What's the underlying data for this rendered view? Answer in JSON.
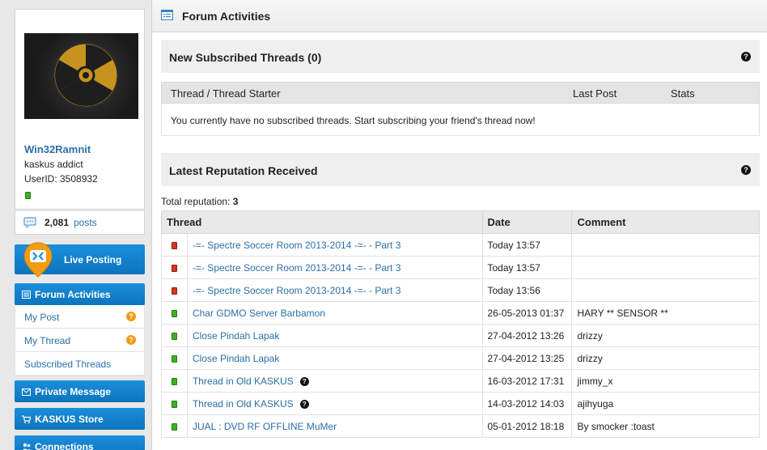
{
  "sidebar": {
    "username": "Win32Ramnit",
    "user_title": "kaskus addict",
    "user_id": "UserID: 3508932",
    "post_count": "2,081",
    "post_label": "posts",
    "live_posting": "Live Posting",
    "nav": {
      "forum_activities": "Forum Activities",
      "my_post": "My Post",
      "my_thread": "My Thread",
      "subscribed_threads": "Subscribed Threads",
      "private_message": "Private Message",
      "kaskus_store": "KASKUS Store",
      "connections": "Connections"
    },
    "help_glyph": "?"
  },
  "main": {
    "page_title": "Forum Activities",
    "subscribed": {
      "title": "New Subscribed Threads (0)",
      "col_thread": "Thread / Thread Starter",
      "col_last_post": "Last Post",
      "col_stats": "Stats",
      "empty_message": "You currently have no subscribed threads. Start subscribing your friend's thread now!"
    },
    "reputation": {
      "title": "Latest Reputation Received",
      "total_label": "Total reputation: ",
      "total_value": "3",
      "col_thread": "Thread",
      "col_date": "Date",
      "col_comment": "Comment",
      "rows": [
        {
          "status": "red",
          "thread": "-=- Spectre Soccer Room 2013-2014 -=- - Part 3",
          "help": false,
          "date": "Today 13:57",
          "comment": ""
        },
        {
          "status": "red",
          "thread": "-=- Spectre Soccer Room 2013-2014 -=- - Part 3",
          "help": false,
          "date": "Today 13:57",
          "comment": ""
        },
        {
          "status": "red",
          "thread": "-=- Spectre Soccer Room 2013-2014 -=- - Part 3",
          "help": false,
          "date": "Today 13:56",
          "comment": ""
        },
        {
          "status": "green",
          "thread": "Char GDMO Server Barbamon",
          "help": false,
          "date": "26-05-2013 01:37",
          "comment": "HARY ** SENSOR **"
        },
        {
          "status": "green",
          "thread": "Close Pindah Lapak",
          "help": false,
          "date": "27-04-2012 13:26",
          "comment": "drizzy"
        },
        {
          "status": "green",
          "thread": "Close Pindah Lapak",
          "help": false,
          "date": "27-04-2012 13:25",
          "comment": "drizzy"
        },
        {
          "status": "green",
          "thread": "Thread in Old KASKUS",
          "help": true,
          "date": "16-03-2012 17:31",
          "comment": "jimmy_x"
        },
        {
          "status": "green",
          "thread": "Thread in Old KASKUS",
          "help": true,
          "date": "14-03-2012 14:03",
          "comment": "ajihyuga"
        },
        {
          "status": "green",
          "thread": "JUAL : DVD RF OFFLINE MuMer",
          "help": false,
          "date": "05-01-2012 18:18",
          "comment": "By smocker :toast"
        }
      ]
    }
  },
  "colors": {
    "accent_blue": "#0d74bd",
    "link": "#2b6fa8",
    "status_red": "#d2391b",
    "status_green": "#3fae28",
    "badge_orange": "#f39c12"
  }
}
